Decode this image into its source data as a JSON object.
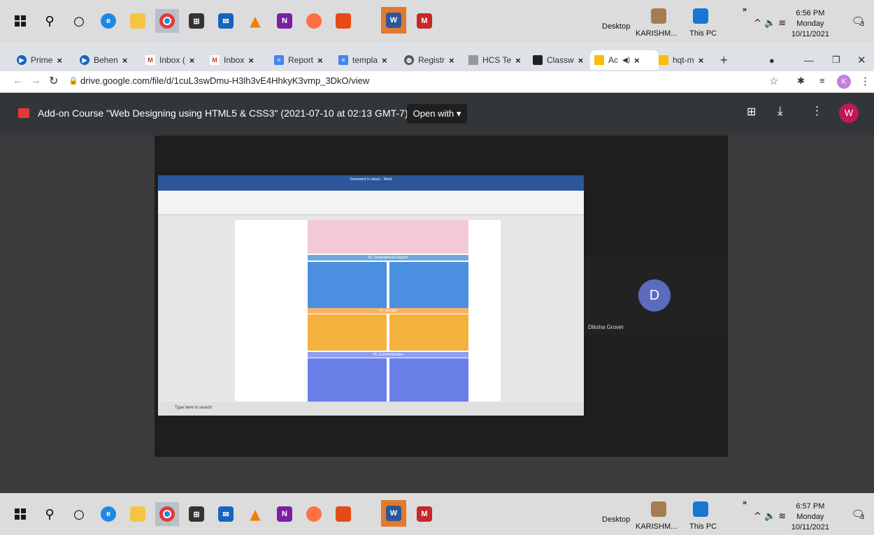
{
  "taskbar_top": {
    "desktop_label": "Desktop",
    "user_label": "KARISHM...",
    "thispc_label": "This PC",
    "time": "6:56 PM",
    "day": "Monday",
    "date": "10/11/2021",
    "notif_count": "3"
  },
  "taskbar_bottom": {
    "desktop_label": "Desktop",
    "user_label": "KARISHM...",
    "thispc_label": "This PC",
    "time": "6:57 PM",
    "day": "Monday",
    "date": "10/11/2021",
    "notif_count": "3"
  },
  "tabs": [
    {
      "label": "Prime"
    },
    {
      "label": "Behen"
    },
    {
      "label": "Inbox ("
    },
    {
      "label": "Inbox"
    },
    {
      "label": "Report"
    },
    {
      "label": "templa"
    },
    {
      "label": "Registr"
    },
    {
      "label": "HCS Te"
    },
    {
      "label": "Classw"
    },
    {
      "label": "Ac"
    },
    {
      "label": "hqt-m"
    }
  ],
  "address": {
    "url": "drive.google.com/file/d/1cuL3swDmu-H3lh3vE4HhkyK3vmp_3DkO/view",
    "profile_initial": "K"
  },
  "drive": {
    "title": "Add-on Course \"Web Designing using HTML5 & CSS3\" (2021-07-10 at 02:13 GMT-7)",
    "open_with": "Open with",
    "avatar_initial": "W"
  },
  "video": {
    "participant_initial": "D",
    "participant_name": "Diksha Grover",
    "word_title": "Document in class1 - Word",
    "search_placeholder": "Type here to search",
    "section_3": "#3. Geographical Support",
    "section_4": "#4. Storage",
    "section_5": "#5. Communication"
  },
  "colors": {
    "tabstrip": "#dee1e6",
    "drive_bar": "#323639",
    "avatar": "#c2185b",
    "participant_avatar": "#5c6bc0"
  }
}
